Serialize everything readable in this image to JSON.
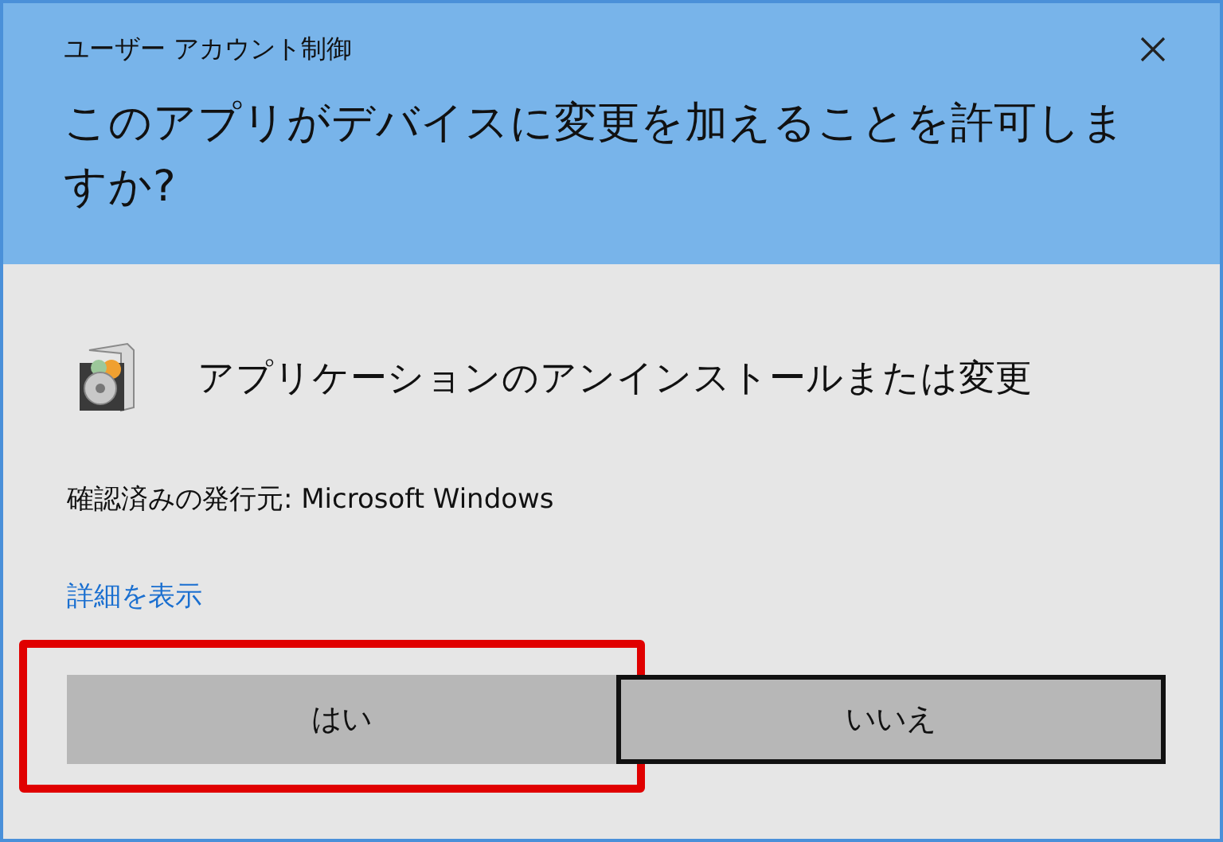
{
  "window": {
    "title": "ユーザー アカウント制御"
  },
  "prompt": "このアプリがデバイスに変更を加えることを許可しますか?",
  "app": {
    "name": "アプリケーションのアンインストールまたは変更"
  },
  "publisher": "確認済みの発行元: Microsoft Windows",
  "details_link": "詳細を表示",
  "buttons": [
    {
      "label": "はい",
      "focused": false,
      "highlighted": true
    },
    {
      "label": "いいえ",
      "focused": true,
      "highlighted": false
    }
  ]
}
